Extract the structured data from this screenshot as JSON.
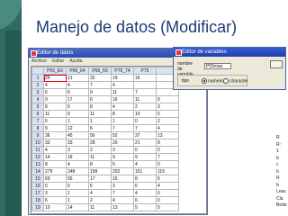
{
  "slide": {
    "title": "Manejo de datos (Modificar)"
  },
  "editor": {
    "title": "Editor de datos",
    "menu": [
      "Archivo",
      "Editar",
      "Ayuda"
    ],
    "columns": [
      "P55_E9",
      "P60_64",
      "P65_69",
      "P70_74",
      "P75"
    ],
    "rows": [
      [
        "1",
        "20",
        "21",
        "32",
        "19",
        "16"
      ],
      [
        "2",
        "4",
        "4",
        "7",
        "4",
        ""
      ],
      [
        "3",
        "6",
        "6",
        "9",
        "11",
        "7"
      ],
      [
        "4",
        "9",
        "17",
        "6",
        "16",
        "11"
      ],
      [
        "5",
        "8",
        "5",
        "8",
        "4",
        "2"
      ],
      [
        "6",
        "11",
        "9",
        "11",
        "8",
        "10"
      ],
      [
        "7",
        "6",
        "1",
        "1",
        "1",
        "0"
      ],
      [
        "8",
        "9",
        "12",
        "6",
        "7",
        "7"
      ],
      [
        "9",
        "36",
        "45",
        "56",
        "52",
        "37"
      ],
      [
        "10",
        "33",
        "33",
        "28",
        "20",
        "21"
      ],
      [
        "11",
        "4",
        "3",
        "2",
        "3",
        "0"
      ],
      [
        "12",
        "14",
        "18",
        "11",
        "9",
        "9"
      ],
      [
        "13",
        "8",
        "4",
        "8",
        "5",
        "4"
      ],
      [
        "14",
        "279",
        "248",
        "199",
        "202",
        "151"
      ],
      [
        "15",
        "69",
        "55",
        "17",
        "15",
        "8"
      ],
      [
        "16",
        "0",
        "6",
        "6",
        "3",
        "6"
      ],
      [
        "17",
        "3",
        "1",
        "4",
        "7",
        "4"
      ],
      [
        "18",
        "6",
        "1",
        "2",
        "4",
        "6"
      ],
      [
        "19",
        "10",
        "14",
        "11",
        "13",
        "5"
      ]
    ],
    "extra_column": [
      "",
      "",
      "",
      "9",
      "3",
      "5",
      "2",
      "4",
      "13",
      "8",
      "0",
      "7",
      "0",
      "115",
      "5",
      "4",
      "6",
      "0",
      "5"
    ]
  },
  "dialog": {
    "title": "Editor de variables",
    "name_label": "nombre de variable",
    "name_value": "P55mas",
    "type_label": "tipo",
    "radio_numeric": "numeric",
    "radio_character": "character",
    "selected_type": "numeric"
  },
  "side_text": [
    "R",
    "R:",
    "1",
    "b",
    "c",
    "b",
    "R",
    "b",
    "Leac",
    "Cla",
    "Bode"
  ]
}
